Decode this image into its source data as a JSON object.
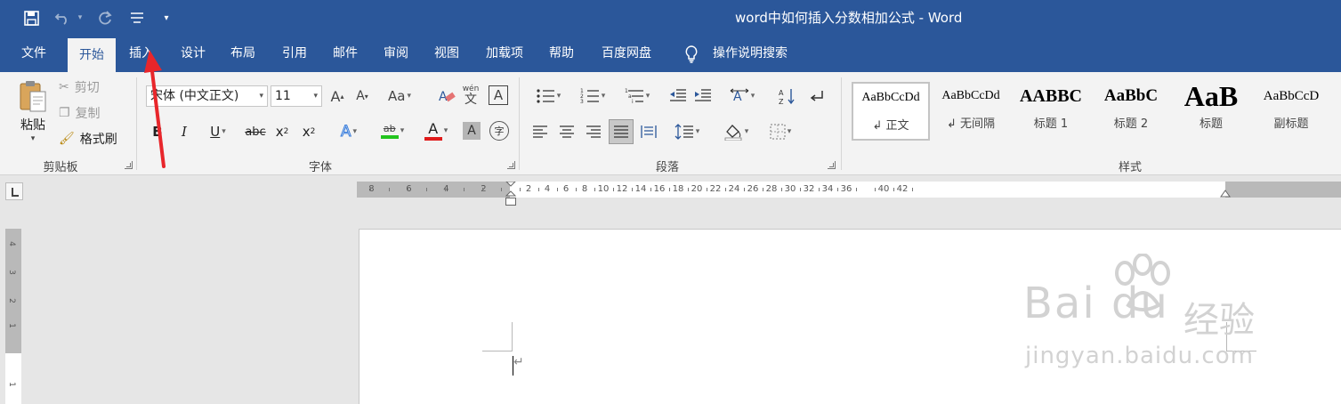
{
  "window": {
    "title": "word中如何插入分数相加公式 - Word"
  },
  "tabs": [
    "文件",
    "开始",
    "插入",
    "设计",
    "布局",
    "引用",
    "邮件",
    "审阅",
    "视图",
    "加载项",
    "帮助",
    "百度网盘"
  ],
  "active_tab": "开始",
  "tell_me": "操作说明搜索",
  "clipboard": {
    "paste": "粘贴",
    "cut": "剪切",
    "copy": "复制",
    "format_painter": "格式刷",
    "group_label": "剪贴板"
  },
  "font": {
    "name": "宋体 (中文正文)",
    "size": "11",
    "grow": "A",
    "shrink": "A",
    "change_case": "Aa",
    "phonetic_top": "wén",
    "phonetic_bottom": "文",
    "border": "A",
    "bold": "B",
    "italic": "I",
    "underline": "U",
    "strike": "abc",
    "subscript_base": "x",
    "subscript": "2",
    "superscript_base": "x",
    "superscript": "2",
    "effects": "A",
    "highlight": "ab",
    "font_color": "A",
    "shading": "A",
    "enclose": "字",
    "group_label": "字体",
    "highlight_color": "#22c41e",
    "font_color_bar": "#e01b1b"
  },
  "paragraph": {
    "group_label": "段落"
  },
  "styles": {
    "group_label": "样式",
    "items": [
      {
        "sample": "AaBbCcDd",
        "name": "↲ 正文"
      },
      {
        "sample": "AaBbCcDd",
        "name": "↲ 无间隔"
      },
      {
        "sample": "AABBC",
        "name": "标题 1"
      },
      {
        "sample": "AaBbC",
        "name": "标题 2"
      },
      {
        "sample": "AaB",
        "name": "标题"
      },
      {
        "sample": "AaBbCcD",
        "name": "副标题"
      }
    ]
  },
  "ruler": {
    "left_labels": [
      "8",
      "6",
      "4",
      "2"
    ],
    "labels": [
      "2",
      "4",
      "6",
      "8",
      "10",
      "12",
      "14",
      "16",
      "18",
      "20",
      "22",
      "24",
      "26",
      "28",
      "30",
      "32",
      "34",
      "36",
      "40",
      "42"
    ],
    "vertical_labels": [
      "4",
      "3",
      "2",
      "1",
      "1"
    ]
  },
  "watermark": {
    "logo": "Bai du",
    "text": "经验",
    "url": "jingyan.baidu.com"
  },
  "colors": {
    "accent": "#2b579a",
    "annotation": "#e8262b"
  }
}
